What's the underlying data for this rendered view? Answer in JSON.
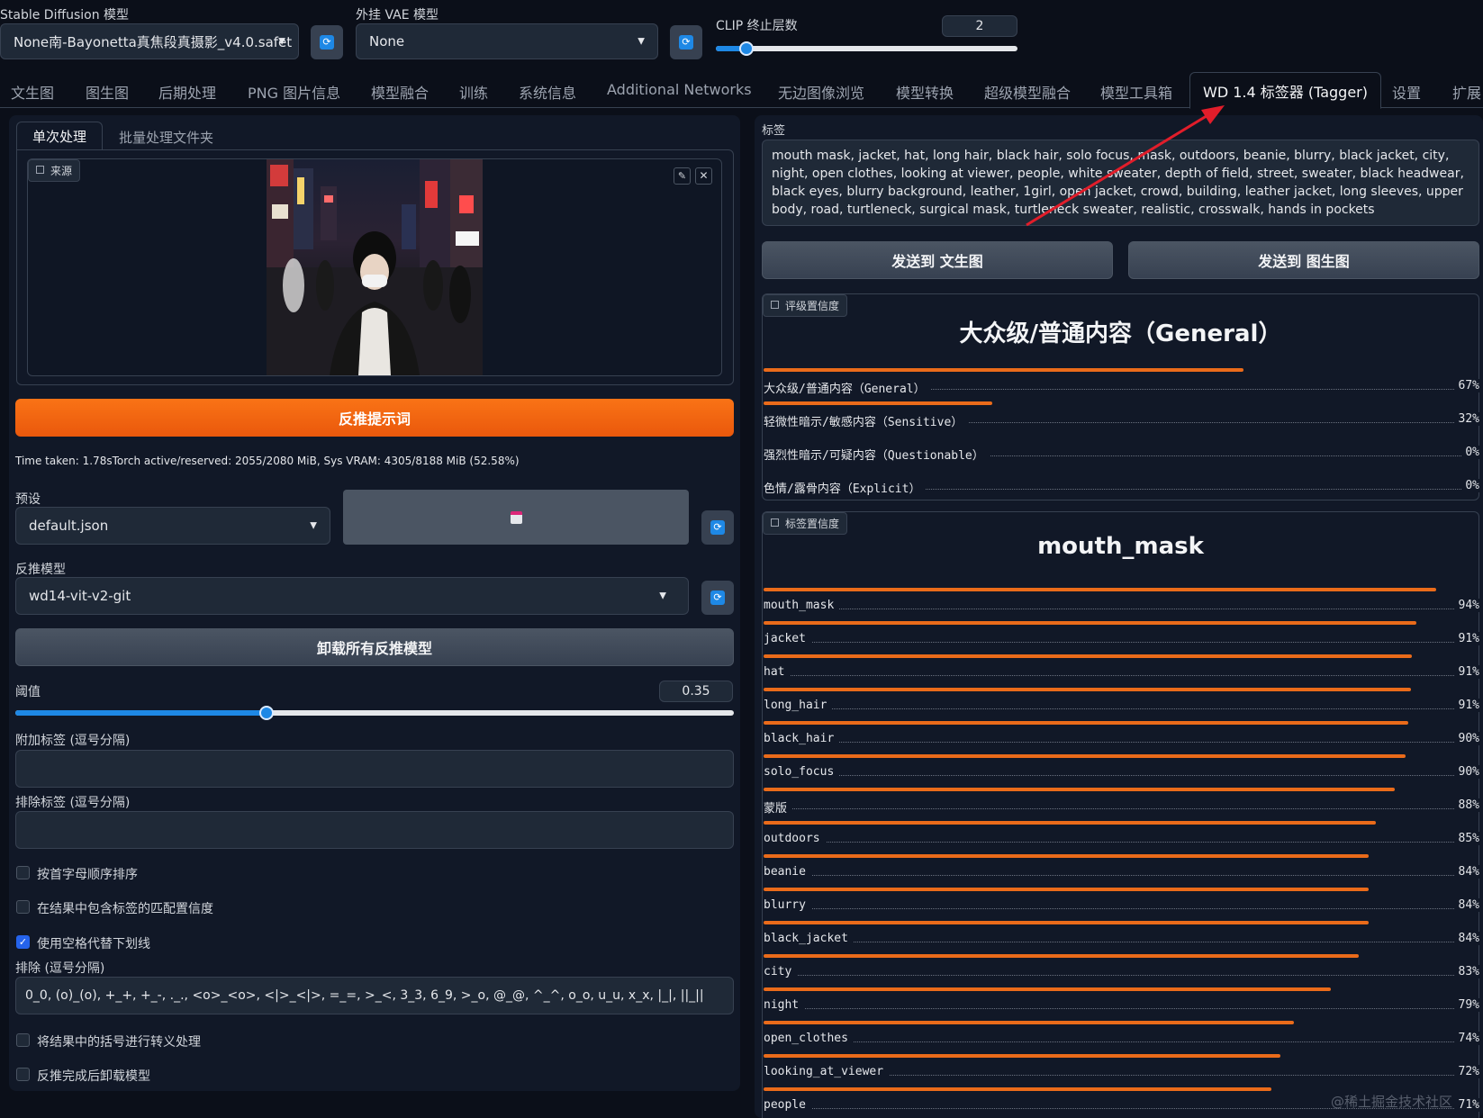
{
  "header": {
    "sd_model_label": "Stable Diffusion 模型",
    "sd_model_value": "None南-Bayonetta真焦段真摄影_v4.0.safet",
    "vae_label": "外挂 VAE 模型",
    "vae_value": "None",
    "clip_label": "CLIP 终止层数",
    "clip_value": "2",
    "clip_fraction": 0.1
  },
  "tabs": [
    "文生图",
    "图生图",
    "后期处理",
    "PNG 图片信息",
    "模型融合",
    "训练",
    "系统信息",
    "Additional Networks",
    "无边图像浏览",
    "模型转换",
    "超级模型融合",
    "模型工具箱",
    "WD 1.4 标签器 (Tagger)",
    "设置",
    "扩展"
  ],
  "left": {
    "subtabs": [
      "单次处理",
      "批量处理文件夹"
    ],
    "source_label": "来源",
    "interrogate_button": "反推提示词",
    "time_info": "Time taken: 1.78sTorch active/reserved: 2055/2080 MiB, Sys VRAM: 4305/8188 MiB (52.58%)",
    "preset_label": "预设",
    "preset_value": "default.json",
    "model_label": "反推模型",
    "model_value": "wd14-vit-v2-git",
    "unload_button": "卸载所有反推模型",
    "threshold_label": "阈值",
    "threshold_value": "0.35",
    "threshold_fraction": 0.35,
    "additional_tags_label": "附加标签 (逗号分隔)",
    "exclude_tags_label": "排除标签 (逗号分隔)",
    "check_sort": "按首字母顺序排序",
    "check_include_conf": "在结果中包含标签的匹配置信度",
    "check_underscore": "使用空格代替下划线",
    "exclude_label": "排除 (逗号分隔)",
    "exclude_value": "0_0, (o)_(o), +_+, +_-, ._., <o>_<o>, <|>_<|>, =_=, >_<, 3_3, 6_9, >_o, @_@, ^_^, o_o, u_u, x_x, |_|, ||_||",
    "check_escape": "将结果中的括号进行转义处理",
    "check_unload_after": "反推完成后卸载模型"
  },
  "right": {
    "tags_label": "标签",
    "tags_text": "mouth mask, jacket, hat, long hair, black hair, solo focus, mask, outdoors, beanie, blurry, black jacket, city, night, open clothes, looking at viewer, people, white sweater, depth of field, street, sweater, black headwear, black eyes, blurry background, leather, 1girl, open jacket, crowd, building, leather jacket, long sleeves, upper body, road, turtleneck, surgical mask, turtleneck sweater, realistic, crosswalk, hands in pockets",
    "send_txt2img": "发送到 文生图",
    "send_img2img": "发送到 图生图",
    "rating_badge": "评级置信度",
    "rating_title": "大众级/普通内容（General）",
    "ratings": [
      {
        "name": "大众级/普通内容（General）",
        "pct": "67%",
        "v": 0.67
      },
      {
        "name": "轻微性暗示/敏感内容（Sensitive）",
        "pct": "32%",
        "v": 0.32
      },
      {
        "name": "强烈性暗示/可疑内容（Questionable）",
        "pct": "0%",
        "v": 0.0
      },
      {
        "name": "色情/露骨内容（Explicit）",
        "pct": "0%",
        "v": 0.0
      }
    ],
    "tag_badge": "标签置信度",
    "tag_title": "mouth_mask",
    "tags": [
      {
        "name": "mouth_mask",
        "pct": "94%",
        "v": 0.94
      },
      {
        "name": "jacket",
        "pct": "91%",
        "v": 0.912
      },
      {
        "name": "hat",
        "pct": "91%",
        "v": 0.906
      },
      {
        "name": "long_hair",
        "pct": "91%",
        "v": 0.905
      },
      {
        "name": "black_hair",
        "pct": "90%",
        "v": 0.9
      },
      {
        "name": "solo_focus",
        "pct": "90%",
        "v": 0.897
      },
      {
        "name": "蒙版",
        "pct": "88%",
        "v": 0.882
      },
      {
        "name": "outdoors",
        "pct": "85%",
        "v": 0.855
      },
      {
        "name": "beanie",
        "pct": "84%",
        "v": 0.845
      },
      {
        "name": "blurry",
        "pct": "84%",
        "v": 0.845
      },
      {
        "name": "black_jacket",
        "pct": "84%",
        "v": 0.845
      },
      {
        "name": "city",
        "pct": "83%",
        "v": 0.832
      },
      {
        "name": "night",
        "pct": "79%",
        "v": 0.793
      },
      {
        "name": "open_clothes",
        "pct": "74%",
        "v": 0.741
      },
      {
        "name": "looking_at_viewer",
        "pct": "72%",
        "v": 0.722
      },
      {
        "name": "people",
        "pct": "71%",
        "v": 0.71
      }
    ]
  },
  "watermark": "@稀土掘金技术社区",
  "colors": {
    "accent": "#ea6b1a",
    "bg": "#0b0f19",
    "panel": "#111827",
    "slider": "#1e88e5",
    "annotation": "#e11d2a"
  }
}
